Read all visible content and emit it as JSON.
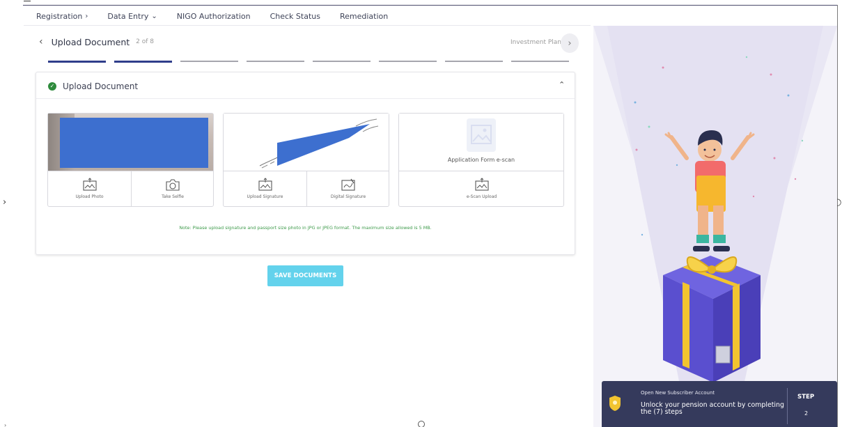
{
  "nav": {
    "items": [
      {
        "label": "Registration",
        "suffix": "›"
      },
      {
        "label": "Data Entry",
        "suffix": "⌄"
      },
      {
        "label": "NIGO Authorization",
        "suffix": ""
      },
      {
        "label": "Check Status",
        "suffix": ""
      },
      {
        "label": "Remediation",
        "suffix": ""
      }
    ]
  },
  "stepper": {
    "back_icon": "chevron-left-icon",
    "title": "Upload Document",
    "count": "2 of 8",
    "next_label": "Investment Plan",
    "next_icon": "chevron-right-icon",
    "total_steps": 8,
    "completed_steps": 2,
    "active_color": "#2f3d8a",
    "inactive_color": "#a5a5ad"
  },
  "card": {
    "title": "Upload Document",
    "check_icon": "check-circle-icon",
    "collapse_icon": "chevron-up-icon",
    "tiles": [
      {
        "name": "photo",
        "buttons": [
          {
            "label": "Upload Photo",
            "icon": "upload-image-icon"
          },
          {
            "label": "Take Selfie",
            "icon": "camera-icon"
          }
        ]
      },
      {
        "name": "signature",
        "buttons": [
          {
            "label": "Upload Signature",
            "icon": "upload-image-icon"
          },
          {
            "label": "Digital Signature",
            "icon": "digital-signature-icon"
          }
        ]
      },
      {
        "name": "application-form",
        "caption": "Application Form e-scan",
        "buttons": [
          {
            "label": "e-Scan Upload",
            "icon": "upload-image-icon"
          }
        ]
      }
    ],
    "note": "Note: Please upload signature and passport size photo in JPG or JPEG format. The maximum size allowed is 5 MB."
  },
  "save_button": {
    "label": "SAVE DOCUMENTS",
    "color": "#63d2ec"
  },
  "banner": {
    "small": "Open New Subscriber Account",
    "text": "Unlock your pension account by completing the (7) steps",
    "step_label": "STEP",
    "step_value": "2",
    "background": "#353a5c",
    "badge_icon": "shield-badge-icon"
  },
  "colors": {
    "redaction": "#3d6fcf",
    "note_text": "#3d9a4a",
    "panel_bg": "#f4f3f9",
    "gift_box": "#5a4fcf",
    "gift_ribbon": "#f2c430"
  }
}
